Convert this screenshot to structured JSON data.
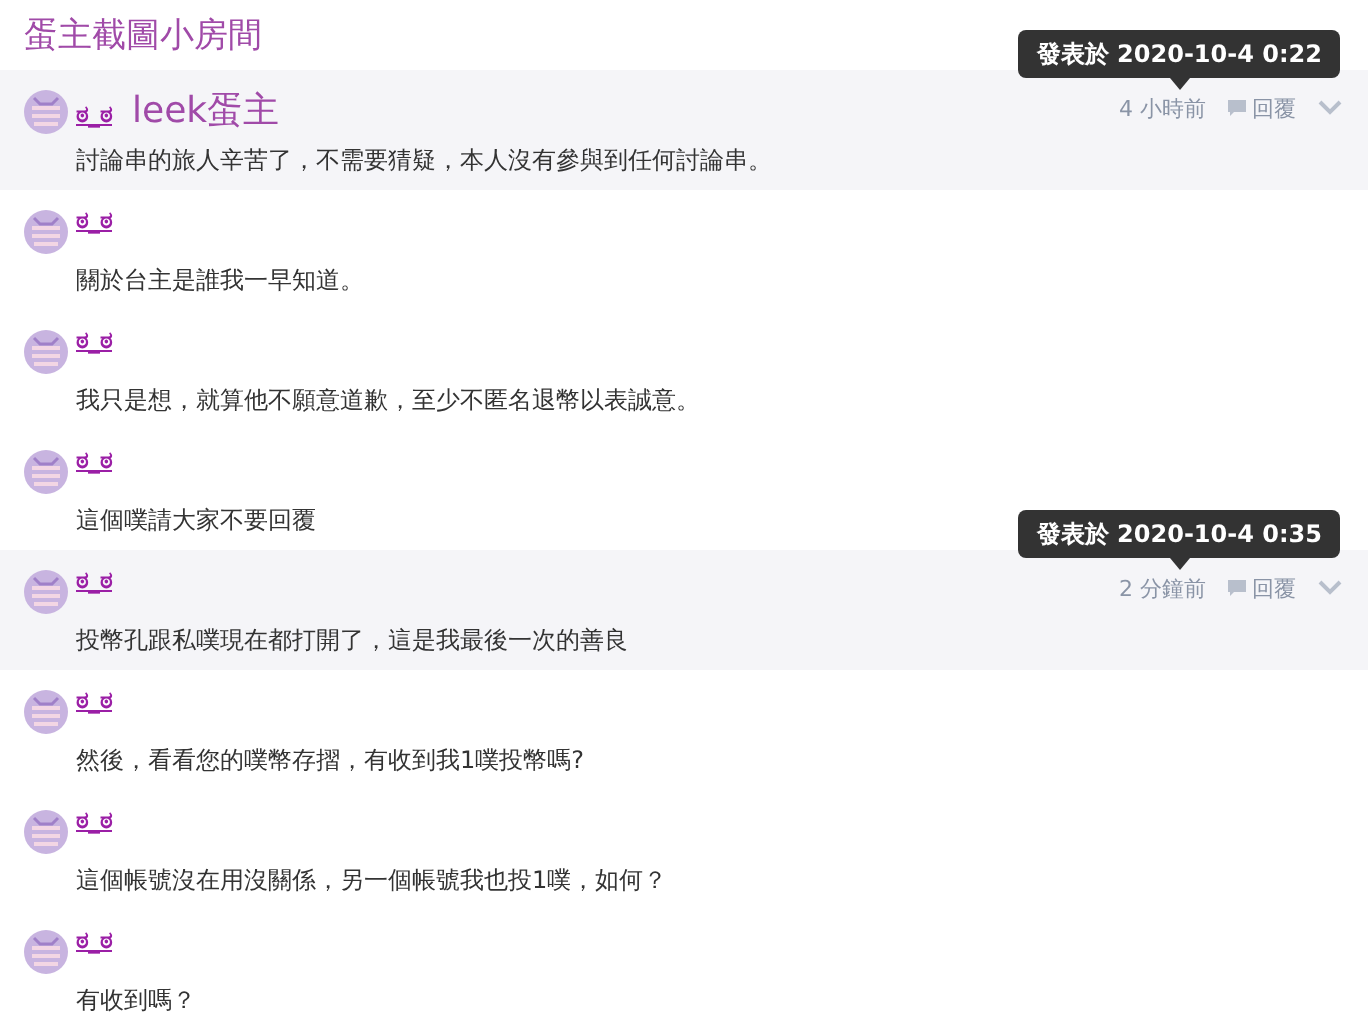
{
  "title": "蛋主截圖小房間",
  "posts": [
    {
      "author": "ಠ_ಠ",
      "badge": "leek蛋主",
      "text": "討論串的旅人辛苦了，不需要猜疑，本人沒有參與到任何討論串。",
      "highlighted": true,
      "time": "4 小時前",
      "reply": "回覆",
      "tooltip": "發表於 2020-10-4 0:22"
    },
    {
      "author": "ಠ_ಠ",
      "text": "關於台主是誰我一早知道。",
      "highlighted": false
    },
    {
      "author": "ಠ_ಠ",
      "text": "我只是想，就算他不願意道歉，至少不匿名退幣以表誠意。",
      "highlighted": false
    },
    {
      "author": "ಠ_ಠ",
      "text": "這個噗請大家不要回覆",
      "highlighted": false
    },
    {
      "author": "ಠ_ಠ",
      "text": "投幣孔跟私噗現在都打開了，這是我最後一次的善良",
      "highlighted": true,
      "time": "2 分鐘前",
      "reply": "回覆",
      "tooltip": "發表於 2020-10-4 0:35"
    },
    {
      "author": "ಠ_ಠ",
      "text": "然後，看看您的噗幣存摺，有收到我1噗投幣嗎?",
      "highlighted": false
    },
    {
      "author": "ಠ_ಠ",
      "text": "這個帳號沒在用沒關係，另一個帳號我也投1噗，如何？",
      "highlighted": false
    },
    {
      "author": "ಠ_ಠ",
      "text": "有收到嗎？",
      "highlighted": false
    }
  ]
}
